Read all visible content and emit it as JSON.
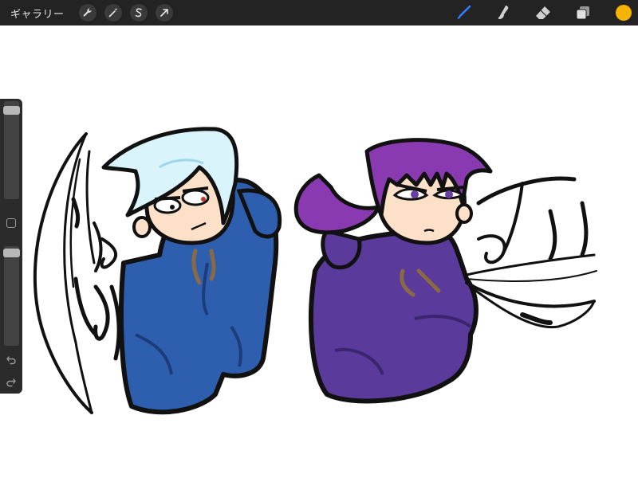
{
  "topbar": {
    "gallery_label": "ギャラリー",
    "left_tools": [
      {
        "name": "actions-wrench-icon"
      },
      {
        "name": "adjustments-wand-icon"
      },
      {
        "name": "selection-s-icon"
      },
      {
        "name": "transform-arrow-icon"
      }
    ],
    "right_tools": [
      {
        "name": "brush-icon",
        "color": "#2f7fff"
      },
      {
        "name": "smudge-icon",
        "color": "#d0d0d0"
      },
      {
        "name": "eraser-icon",
        "color": "#d0d0d0"
      },
      {
        "name": "layers-icon",
        "color": "#d0d0d0"
      }
    ],
    "current_color": "#f5b400"
  },
  "sidebar": {
    "brush_size_level": 0.05,
    "opacity_level": 0.03
  },
  "canvas": {
    "hoodie_left_color": "#2e5fae",
    "hoodie_right_color": "#5a3a9a",
    "hair_left_color": "#d9f4fb",
    "hair_right_color": "#8a3ab0",
    "skin_color": "#fde0c8"
  }
}
